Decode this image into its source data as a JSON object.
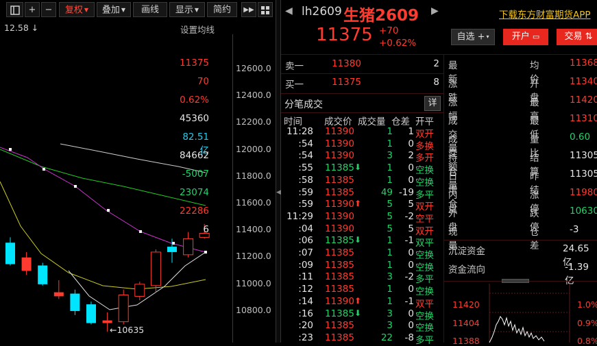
{
  "toolbar": {
    "add": "+",
    "minus": "−",
    "left": "←",
    "right": "→",
    "fuquan": "复权",
    "diejia": "叠加",
    "huaxian": "画线",
    "xianshi": "显示",
    "jianyue": "简约"
  },
  "chart": {
    "top_value": "12.58",
    "ma_settings": "设置均线",
    "y_ticks": [
      "12600.0",
      "12400.0",
      "12200.0",
      "12000.0",
      "11800.0",
      "11600.0",
      "11400.0",
      "11200.0",
      "11000.0",
      "10800.0"
    ],
    "low_marker": "←10635"
  },
  "chart_data": {
    "type": "candlestick",
    "ylim": [
      10700,
      12700
    ],
    "candles": [
      {
        "o": 11300,
        "h": 11340,
        "l": 11130,
        "c": 11140,
        "color": "cyan"
      },
      {
        "o": 11190,
        "h": 11230,
        "l": 11060,
        "c": 11090,
        "color": "red"
      },
      {
        "o": 11130,
        "h": 11150,
        "l": 10980,
        "c": 10990,
        "color": "cyan"
      },
      {
        "o": 10930,
        "h": 11020,
        "l": 10880,
        "c": 10900,
        "color": "red"
      },
      {
        "o": 10920,
        "h": 10950,
        "l": 10760,
        "c": 10790,
        "color": "cyan"
      },
      {
        "o": 10840,
        "h": 10860,
        "l": 10690,
        "c": 10700,
        "color": "cyan"
      },
      {
        "o": 10720,
        "h": 10780,
        "l": 10635,
        "c": 10700,
        "color": "red"
      },
      {
        "o": 10710,
        "h": 10950,
        "l": 10690,
        "c": 10910,
        "color": "red"
      },
      {
        "o": 10900,
        "h": 11010,
        "l": 10870,
        "c": 10990,
        "color": "red"
      },
      {
        "o": 10980,
        "h": 11250,
        "l": 10930,
        "c": 11230,
        "color": "red"
      },
      {
        "o": 11270,
        "h": 11330,
        "l": 11150,
        "c": 11230,
        "color": "cyan"
      },
      {
        "o": 11210,
        "h": 11380,
        "l": 11190,
        "c": 11330,
        "color": "red"
      },
      {
        "o": 11340,
        "h": 11440,
        "l": 11330,
        "c": 11370,
        "color": "red"
      }
    ]
  },
  "header": {
    "code": "lh2609",
    "name": "生猪2609",
    "download": "下载东方财富期货APP",
    "price": "11375",
    "change": "+70",
    "change_pct": "+0.62%",
    "zixuan": "自选",
    "kaihu": "开户",
    "jiaoyi": "交易"
  },
  "orderbook": {
    "sell_label": "卖一",
    "sell_price": "11380",
    "sell_vol": "2",
    "buy_label": "买一",
    "buy_price": "11375",
    "buy_vol": "8"
  },
  "trades_panel": {
    "title": "分笔成交",
    "detail": "详",
    "headers": [
      "时间",
      "成交价",
      "成交量",
      "仓差",
      "开平"
    ],
    "rows": [
      [
        "11:28",
        "11390",
        "",
        "1",
        "1",
        "双开",
        "red",
        "red"
      ],
      [
        ":54",
        "11390",
        "",
        "1",
        "0",
        "多换",
        "red",
        "red"
      ],
      [
        ":54",
        "11390",
        "",
        "3",
        "2",
        "多开",
        "red",
        "red"
      ],
      [
        ":55",
        "11385",
        "⬇",
        "1",
        "0",
        "空换",
        "green",
        "green"
      ],
      [
        ":58",
        "11385",
        "",
        "1",
        "0",
        "空换",
        "red",
        "green"
      ],
      [
        ":59",
        "11385",
        "",
        "49",
        "-19",
        "多平",
        "red",
        "green"
      ],
      [
        ":59",
        "11390",
        "⬆",
        "5",
        "5",
        "双开",
        "red",
        "red"
      ],
      [
        "11:29",
        "11390",
        "",
        "5",
        "-2",
        "空平",
        "red",
        "red"
      ],
      [
        ":04",
        "11390",
        "",
        "5",
        "5",
        "双开",
        "red",
        "red"
      ],
      [
        ":06",
        "11385",
        "⬇",
        "1",
        "-1",
        "双平",
        "green",
        "green"
      ],
      [
        ":07",
        "11385",
        "",
        "1",
        "0",
        "空换",
        "red",
        "green"
      ],
      [
        ":09",
        "11385",
        "",
        "1",
        "0",
        "空换",
        "red",
        "green"
      ],
      [
        ":11",
        "11385",
        "",
        "3",
        "-2",
        "多平",
        "red",
        "green"
      ],
      [
        ":12",
        "11385",
        "",
        "1",
        "0",
        "空换",
        "red",
        "green"
      ],
      [
        ":14",
        "11390",
        "⬆",
        "1",
        "-1",
        "双平",
        "red",
        "red"
      ],
      [
        ":16",
        "11385",
        "⬇",
        "3",
        "0",
        "空换",
        "green",
        "green"
      ],
      [
        ":20",
        "11385",
        "",
        "3",
        "0",
        "空换",
        "red",
        "green"
      ],
      [
        ":23",
        "11385",
        "",
        "22",
        "-8",
        "多平",
        "red",
        "green"
      ]
    ]
  },
  "stats": {
    "left": [
      [
        "最新",
        "11375",
        "red"
      ],
      [
        "涨跌",
        "70",
        "red"
      ],
      [
        "涨幅",
        "0.62%",
        "red"
      ],
      [
        "成交量",
        "45360",
        "white"
      ],
      [
        "成交额",
        "82.51亿",
        "cyan"
      ],
      [
        "持仓量",
        "84662",
        "white"
      ],
      [
        "日增仓",
        "-5007",
        "green"
      ],
      [
        "内盘",
        "23074",
        "green"
      ],
      [
        "外盘",
        "22286",
        "red"
      ],
      [
        "现量",
        "6",
        "white"
      ]
    ],
    "right": [
      [
        "均价",
        "11368",
        "red"
      ],
      [
        "开盘",
        "11340",
        "red"
      ],
      [
        "最高",
        "11420",
        "red"
      ],
      [
        "最低",
        "11310",
        "red"
      ],
      [
        "量比",
        "0.60",
        "green"
      ],
      [
        "结算",
        "11305",
        "white"
      ],
      [
        "昨结",
        "11305",
        "white"
      ],
      [
        "涨停",
        "11980",
        "red"
      ],
      [
        "跌停",
        "10630",
        "green"
      ],
      [
        "仓差",
        "-3",
        "white"
      ]
    ],
    "chendian_label": "沉淀资金",
    "chendian_value": "24.65亿",
    "zijin_label": "资金流向",
    "zijin_value": "-1.39亿"
  },
  "mini_chart": {
    "y_labels": [
      "11420",
      "11404",
      "11388"
    ],
    "pct_labels": [
      "1.0%",
      "0.9%",
      "0.8%"
    ]
  }
}
